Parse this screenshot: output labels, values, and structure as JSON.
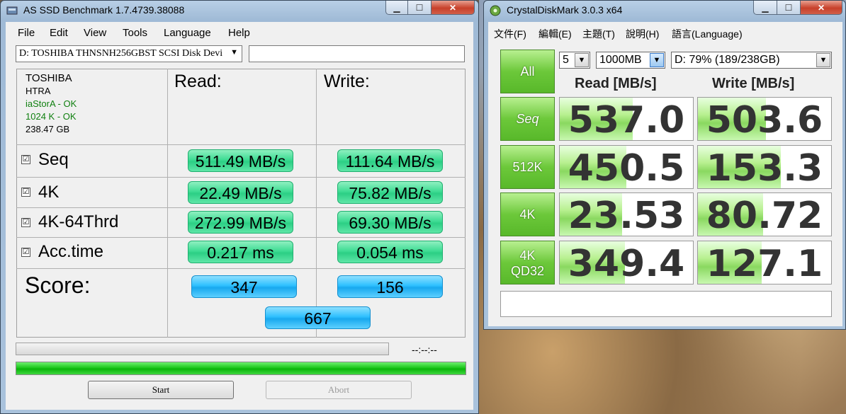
{
  "as_ssd": {
    "title": "AS SSD Benchmark 1.7.4739.38088",
    "menu": [
      "File",
      "Edit",
      "View",
      "Tools",
      "Language",
      "Help"
    ],
    "drive_select": "D: TOSHIBA THNSNH256GBST SCSI Disk Devi",
    "drive_info": {
      "vendor": "TOSHIBA",
      "firmware": "HTRA",
      "driver": "iaStorA - OK",
      "alignment": "1024 K - OK",
      "size": "238.47 GB"
    },
    "read_header": "Read:",
    "write_header": "Write:",
    "rows": [
      {
        "label": "Seq",
        "read": "511.49 MB/s",
        "write": "111.64 MB/s"
      },
      {
        "label": "4K",
        "read": "22.49 MB/s",
        "write": "75.82 MB/s"
      },
      {
        "label": "4K-64Thrd",
        "read": "272.99 MB/s",
        "write": "69.30 MB/s"
      },
      {
        "label": "Acc.time",
        "read": "0.217 ms",
        "write": "0.054 ms"
      }
    ],
    "score_label": "Score:",
    "score_read": "347",
    "score_write": "156",
    "score_total": "667",
    "time_display": "--:--:--",
    "progress_fraction": 1.0,
    "start_label": "Start",
    "abort_label": "Abort",
    "check_glyph": "☑"
  },
  "cdm": {
    "title": "CrystalDiskMark 3.0.3 x64",
    "menu": [
      "文件(F)",
      "編輯(E)",
      "主題(T)",
      "說明(H)",
      "語言(Language)"
    ],
    "all_label": "All",
    "count_select": "5",
    "size_select": "1000MB",
    "drive_select": "D: 79% (189/238GB)",
    "read_header": "Read [MB/s]",
    "write_header": "Write [MB/s]",
    "rows": [
      {
        "label": "Seq",
        "label2": "",
        "read": "537.0",
        "write": "503.6",
        "read_fill": 0.55,
        "write_fill": 0.51
      },
      {
        "label": "512K",
        "label2": "",
        "read": "450.5",
        "write": "153.3",
        "read_fill": 0.5,
        "write_fill": 0.62
      },
      {
        "label": "4K",
        "label2": "",
        "read": "23.53",
        "write": "80.72",
        "read_fill": 0.47,
        "write_fill": 0.49
      },
      {
        "label": "4K",
        "label2": "QD32",
        "read": "349.4",
        "write": "127.1",
        "read_fill": 0.49,
        "write_fill": 0.48
      }
    ],
    "comment": ""
  }
}
